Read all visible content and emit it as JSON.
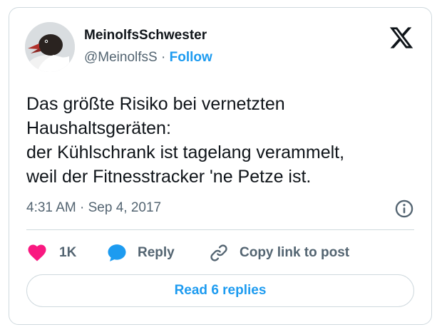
{
  "author": {
    "display_name": "MeinolfsSchwester",
    "handle": "@MeinolfsS",
    "separator": "·",
    "follow_label": "Follow"
  },
  "tweet": {
    "lines": [
      "Das größte Risiko bei vernetzten",
      "Haushaltsgeräten:",
      "der Kühlschrank ist tagelang verammelt,",
      "weil der Fitnesstracker 'ne Petze ist."
    ],
    "time": "4:31 AM",
    "separator": "·",
    "date": "Sep 4, 2017"
  },
  "actions": {
    "like_count": "1K",
    "reply_label": "Reply",
    "copy_label": "Copy link to post"
  },
  "replies_button": {
    "label": "Read 6 replies"
  },
  "colors": {
    "accent": "#1d9bf0",
    "like": "#f91880",
    "text": "#0f1419",
    "secondary": "#536471",
    "border": "#cfd9de"
  },
  "icons": {
    "platform": "x-logo-icon",
    "info": "info-icon",
    "like": "heart-icon",
    "reply": "speech-bubble-icon",
    "copy": "link-icon"
  }
}
